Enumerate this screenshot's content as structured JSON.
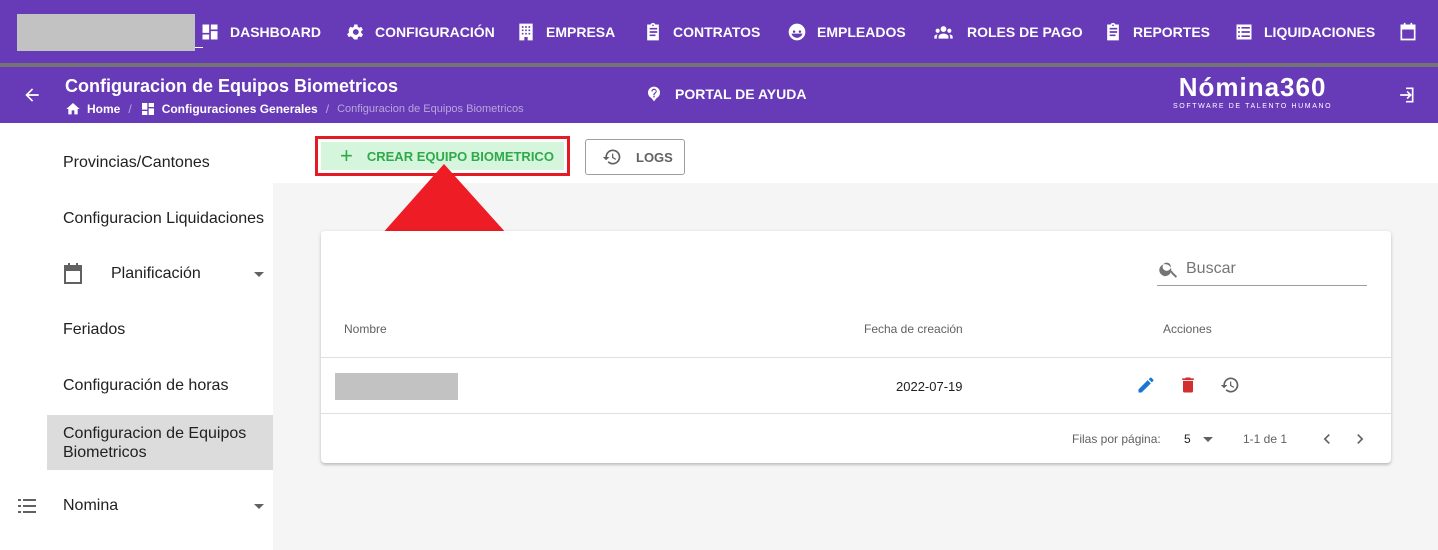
{
  "topnav": {
    "items": [
      {
        "label": "DASHBOARD",
        "icon": "dashboard-icon"
      },
      {
        "label": "CONFIGURACIÓN",
        "icon": "gear-icon"
      },
      {
        "label": "EMPRESA",
        "icon": "building-icon"
      },
      {
        "label": "CONTRATOS",
        "icon": "clipboard-icon"
      },
      {
        "label": "EMPLEADOS",
        "icon": "face-icon"
      },
      {
        "label": "ROLES DE PAGO",
        "icon": "group-icon"
      },
      {
        "label": "REPORTES",
        "icon": "clipboard-icon"
      },
      {
        "label": "LIQUIDACIONES",
        "icon": "list-icon"
      },
      {
        "label": "",
        "icon": "calendar-icon"
      }
    ]
  },
  "header": {
    "title": "Configuracion de Equipos Biometricos",
    "breadcrumb": {
      "home": "Home",
      "section": "Configuraciones Generales",
      "current": "Configuracion de Equipos Biometricos"
    },
    "help": "PORTAL DE AYUDA",
    "brand": {
      "name": "Nómina360",
      "tagline": "SOFTWARE DE TALENTO HUMANO"
    }
  },
  "sidebar": {
    "items": [
      {
        "label": "Provincias/Cantones"
      },
      {
        "label": "Configuracion Liquidaciones"
      },
      {
        "label": "Planificación",
        "icon": "calendar-icon",
        "expandable": true
      },
      {
        "label": "Feriados"
      },
      {
        "label": "Configuración de horas"
      },
      {
        "label": "Configuracion de Equipos Biometricos",
        "active": true
      },
      {
        "label": "Nomina",
        "icon": "list-icon",
        "expandable": true
      }
    ]
  },
  "toolbar": {
    "create_label": "CREAR EQUIPO BIOMETRICO",
    "logs_label": "LOGS"
  },
  "table": {
    "search_placeholder": "Buscar",
    "columns": [
      "Nombre",
      "Fecha de creación",
      "Acciones"
    ],
    "rows": [
      {
        "nombre": "",
        "fecha": "2022-07-19"
      }
    ],
    "footer": {
      "rows_per_page_label": "Filas por página:",
      "rows_per_page": "5",
      "range": "1-1 de 1"
    }
  },
  "colors": {
    "primary": "#673ab7",
    "create_green": "#2eaa4a",
    "highlight_red": "#e51b24",
    "edit_blue": "#1976d2",
    "delete_red": "#d32f2f"
  }
}
